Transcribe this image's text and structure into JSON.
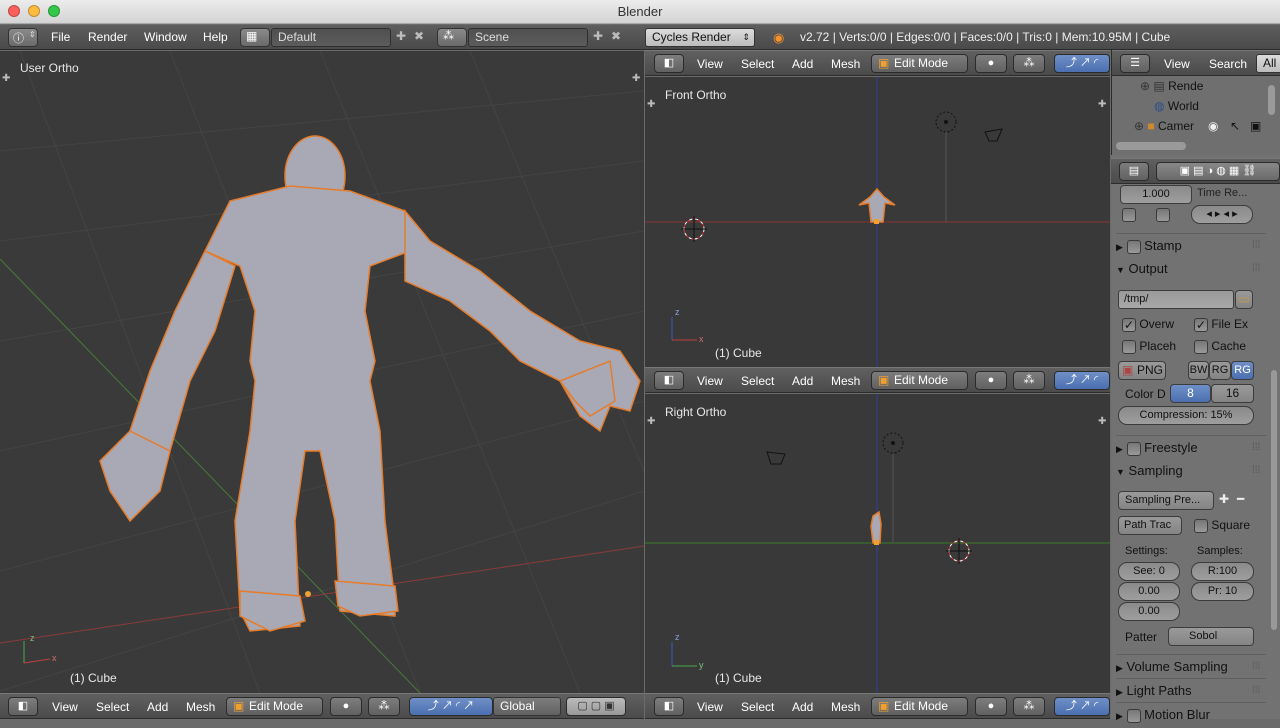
{
  "window": {
    "title": "Blender",
    "close_color": "#fc605c",
    "min_color": "#fdbc40",
    "max_color": "#34c84a"
  },
  "infobar": {
    "menus": [
      "File",
      "Render",
      "Window",
      "Help"
    ],
    "screen_layout": "Default",
    "scene": "Scene",
    "render_engine": "Cycles Render",
    "stats": "v2.72 | Verts:0/0 | Edges:0/0 | Faces:0/0 | Tris:0 | Mem:10.95M | Cube"
  },
  "viewports": {
    "main": {
      "label": "User Ortho",
      "object": "(1) Cube"
    },
    "front": {
      "label": "Front Ortho",
      "object": "(1) Cube"
    },
    "right": {
      "label": "Right Ortho",
      "object": "(1) Cube"
    }
  },
  "view_header": {
    "menus": [
      "View",
      "Select",
      "Add",
      "Mesh"
    ],
    "mode": "Edit Mode",
    "orientation": "Global"
  },
  "outliner": {
    "menus": [
      "View",
      "Search"
    ],
    "filter": "All",
    "items": [
      "Rende",
      "World",
      "Camer"
    ]
  },
  "properties": {
    "res_value": "1.000",
    "time_remap": "Time Re...",
    "sections": {
      "stamp": "Stamp",
      "output": "Output",
      "freestyle": "Freestyle",
      "sampling": "Sampling",
      "volume_sampling": "Volume Sampling",
      "light_paths": "Light Paths",
      "motion_blur": "Motion Blur"
    },
    "output_path": "/tmp/",
    "overwrite": "Overw",
    "file_ext": "File Ex",
    "placeholders": "Placeh",
    "cache": "Cache",
    "file_format": "PNG",
    "color_modes": [
      "BW",
      "RG",
      "RG"
    ],
    "color_depth_label": "Color D",
    "color_depths": [
      "8",
      "16"
    ],
    "compression": "Compression:",
    "compression_value": "15%",
    "sampling_preset": "Sampling Pre...",
    "integrator": "Path Trac",
    "square": "Square",
    "settings_label": "Settings:",
    "samples_label": "Samples:",
    "seed": "See:",
    "seed_value": "0",
    "clamp1": "0.00",
    "clamp2": "0.00",
    "render_samples": "R:",
    "render_samples_value": "100",
    "preview_samples": "Pr:",
    "preview_samples_value": "10",
    "pattern_label": "Patter",
    "pattern": "Sobol"
  }
}
